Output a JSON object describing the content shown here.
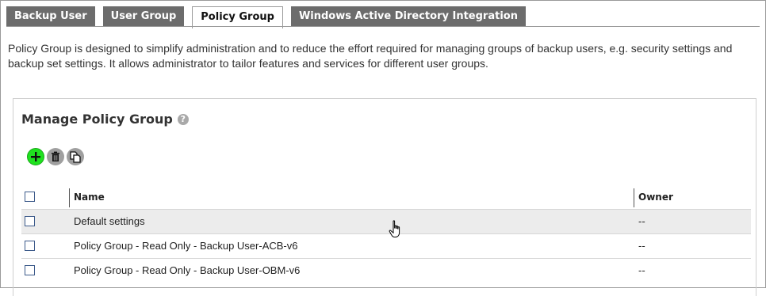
{
  "tabs": [
    {
      "label": "Backup User",
      "active": false
    },
    {
      "label": "User Group",
      "active": false
    },
    {
      "label": "Policy Group",
      "active": true
    },
    {
      "label": "Windows Active Directory Integration",
      "active": false
    }
  ],
  "description": "Policy Group is designed to simplify administration and to reduce the effort required for managing groups of backup users, e.g. security settings and backup set settings. It allows administrator to tailor features and services for different user groups.",
  "panel": {
    "title": "Manage Policy Group",
    "help_icon": "?",
    "toolbar": {
      "add_icon": "plus-icon",
      "delete_icon": "trash-icon",
      "copy_icon": "copy-icon",
      "add_color": "#1fe11f"
    }
  },
  "table": {
    "columns": {
      "name": "Name",
      "owner": "Owner"
    },
    "rows": [
      {
        "name": "Default settings",
        "owner": "--"
      },
      {
        "name": "Policy Group - Read Only - Backup User-ACB-v6",
        "owner": "--"
      },
      {
        "name": "Policy Group - Read Only - Backup User-OBM-v6",
        "owner": "--"
      }
    ]
  }
}
